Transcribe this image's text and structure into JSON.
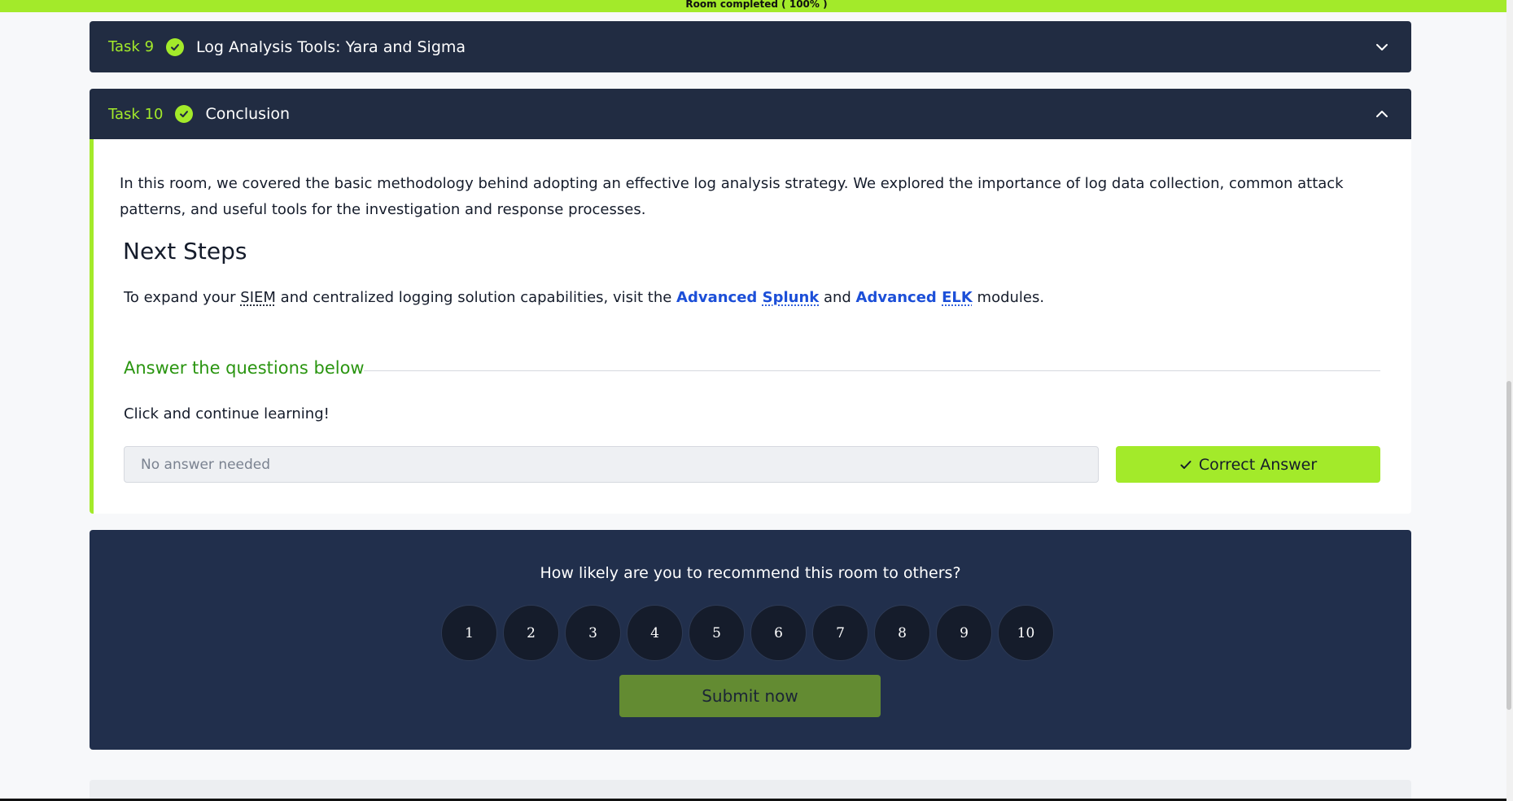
{
  "progress_banner": "Room completed ( 100% )",
  "tasks": [
    {
      "number": "Task 9",
      "title": "Log Analysis Tools: Yara and Sigma",
      "expanded": false
    },
    {
      "number": "Task 10",
      "title": "Conclusion",
      "expanded": true
    }
  ],
  "conclusion": {
    "paragraph": "In this room, we covered the basic methodology behind adopting an effective log analysis strategy. We explored the importance of log data collection, common attack patterns, and useful tools for the investigation and response processes.",
    "heading": "Next Steps",
    "next_steps": {
      "prefix": "To expand your ",
      "siem": "SIEM",
      "middle": " and centralized logging solution capabilities, visit the ",
      "link1_word": "Advanced",
      "link1_abbr": "Splunk",
      "and": " and ",
      "link2_word": "Advanced",
      "link2_abbr": "ELK",
      "suffix": " modules."
    },
    "answer_heading": "Answer the questions below",
    "question": "Click and continue learning!",
    "answer_placeholder": "No answer needed",
    "correct_button": "Correct Answer"
  },
  "recommend": {
    "question": "How likely are you to recommend this room to others?",
    "ratings": [
      "1",
      "2",
      "3",
      "4",
      "5",
      "6",
      "7",
      "8",
      "9",
      "10"
    ],
    "submit": "Submit now"
  },
  "colors": {
    "accent": "#a3ea2a",
    "header_bg": "#212c42",
    "link": "#1c4fd8",
    "answer_heading": "#2a9510"
  },
  "icons": {
    "task_status": "check-circle-icon",
    "collapsed": "chevron-down-icon",
    "expanded": "chevron-up-icon",
    "correct": "checkmark-icon"
  }
}
